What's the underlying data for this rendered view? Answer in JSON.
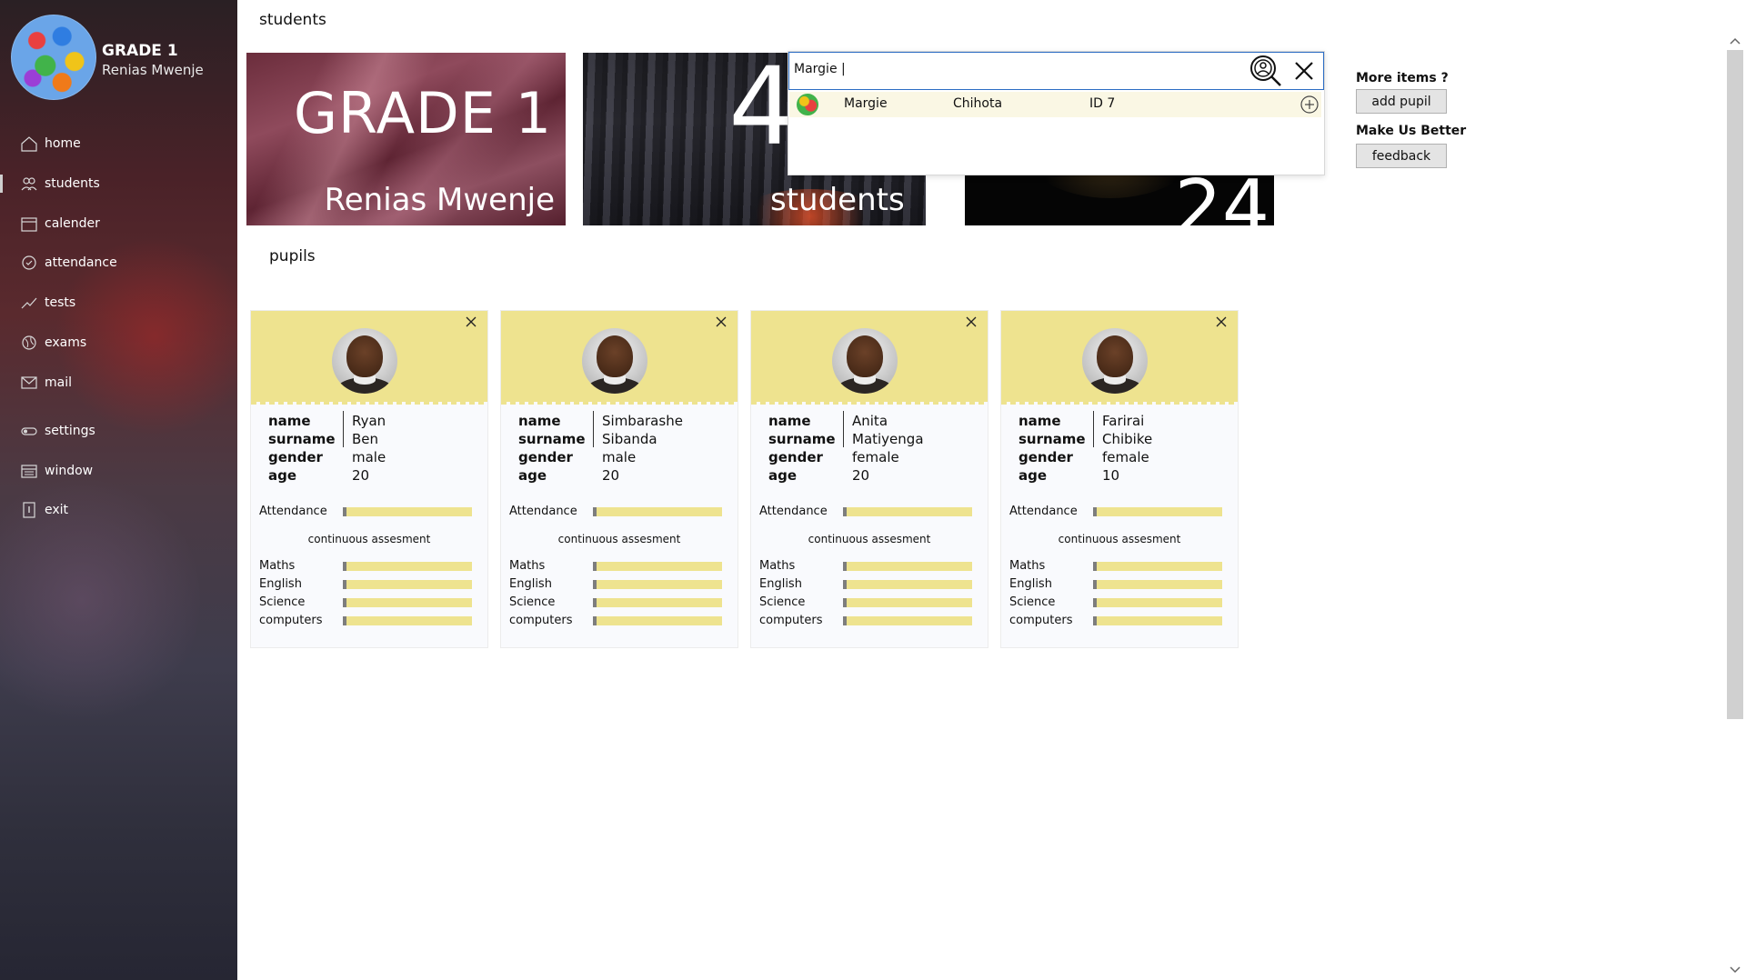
{
  "sidebar": {
    "brand_title": "GRADE 1",
    "brand_subtitle": "Renias Mwenje",
    "items": [
      {
        "label": "home",
        "icon": "home-icon"
      },
      {
        "label": "students",
        "icon": "students-icon",
        "active": true
      },
      {
        "label": "calender",
        "icon": "calendar-icon"
      },
      {
        "label": "attendance",
        "icon": "attendance-icon"
      },
      {
        "label": "tests",
        "icon": "chart-line-icon"
      },
      {
        "label": "exams",
        "icon": "globe-icon"
      },
      {
        "label": "mail",
        "icon": "mail-icon"
      },
      {
        "label": "settings",
        "icon": "toggle-icon"
      },
      {
        "label": "window",
        "icon": "window-icon"
      },
      {
        "label": "exit",
        "icon": "exit-icon"
      }
    ]
  },
  "header": {
    "title": "students"
  },
  "tiles": {
    "grade": {
      "big": "GRADE 1",
      "name": "Renias Mwenje"
    },
    "students": {
      "big": "4",
      "label": "students"
    },
    "third": {
      "big": "24"
    }
  },
  "search": {
    "value": "Margie |",
    "result": {
      "first_name": "Margie",
      "last_name": "Chihota",
      "id": "ID 7"
    }
  },
  "right_panel": {
    "more_items_title": "More items ?",
    "add_pupil_label": "add pupil",
    "feedback_title": "Make Us Better",
    "feedback_label": "feedback"
  },
  "pupils_section": {
    "title": "pupils",
    "field_labels": {
      "name": "name",
      "surname": "surname",
      "gender": "gender",
      "age": "age"
    },
    "attendance_label": "Attendance",
    "ca_title": "continuous assesment",
    "subject_labels": [
      "Maths",
      "English",
      "Science",
      "computers"
    ]
  },
  "pupils": [
    {
      "name": "Ryan",
      "surname": "Ben",
      "gender": "male",
      "age": "20",
      "attendance": 0.03,
      "scores": [
        0.03,
        0.03,
        0.03,
        0.03
      ]
    },
    {
      "name": "Simbarashe",
      "surname": "Sibanda",
      "gender": "male",
      "age": "20",
      "attendance": 0.03,
      "scores": [
        0.03,
        0.03,
        0.03,
        0.03
      ]
    },
    {
      "name": "Anita",
      "surname": "Matiyenga",
      "gender": "female",
      "age": "20",
      "attendance": 0.03,
      "scores": [
        0.03,
        0.03,
        0.03,
        0.03
      ]
    },
    {
      "name": "Farirai",
      "surname": "Chibike",
      "gender": "female",
      "age": "10",
      "attendance": 0.03,
      "scores": [
        0.03,
        0.03,
        0.03,
        0.03
      ]
    }
  ],
  "colors": {
    "card_header": "#eee38f",
    "bar_fill": "#7d7d7d",
    "search_border": "#2c6dc4"
  }
}
